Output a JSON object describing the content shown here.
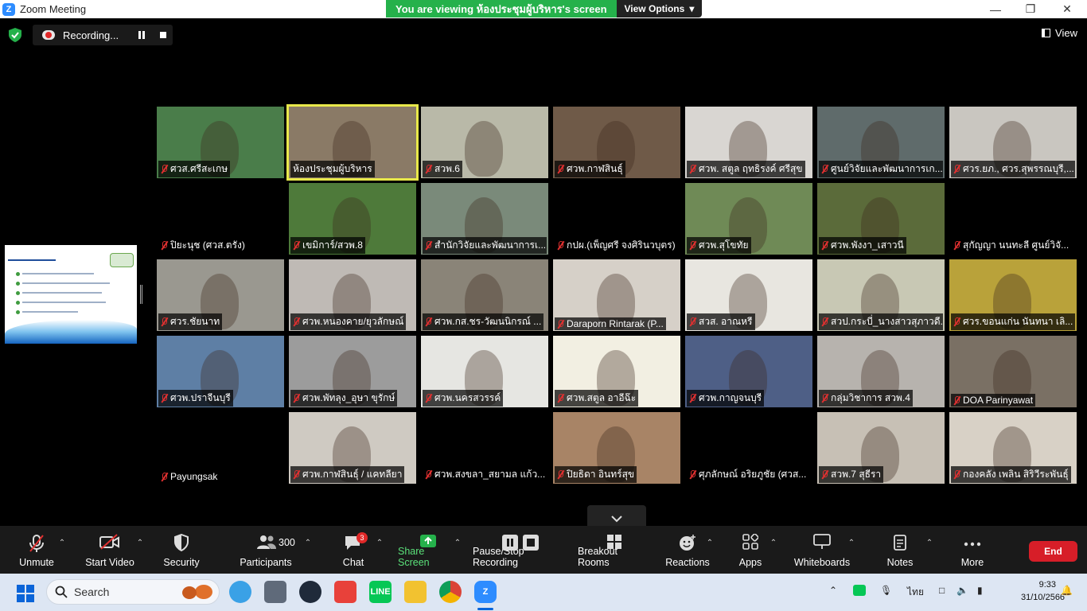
{
  "window": {
    "title": "Zoom Meeting",
    "banner_text": "You are viewing ห้องประชุมผู้บริหาร's screen",
    "view_options": "View Options"
  },
  "top_bar": {
    "recording_label": "Recording...",
    "view_label": "View"
  },
  "participants": [
    {
      "name": "ศวส.ศรีสะเกษ",
      "bg": "#4a7d4a"
    },
    {
      "name": "ห้องประชุมผู้บริหาร",
      "bg": "#8a7a66"
    },
    {
      "name": "สวพ.6",
      "bg": "#b9b9a8"
    },
    {
      "name": "ศวพ.กาฬสินธุ์",
      "bg": "#6f5a48"
    },
    {
      "name": "ศวพ. สตูล ฤทธิรงค์ ศรีสุข",
      "bg": "#d9d6d2"
    },
    {
      "name": "ศูนย์วิจัยและพัฒนาการเก...",
      "bg": "#5f6b6b"
    },
    {
      "name": "ศวร.ยภ., ศวร.สุพรรณบุรี,...",
      "bg": "#c9c6c0"
    },
    {
      "name": "ปิยะนุช (ศวส.ตรัง)",
      "bg": "#000000"
    },
    {
      "name": "เขมิการ์/สวพ.8",
      "bg": "#4e7a3a"
    },
    {
      "name": "สำนักวิจัยและพัฒนาการเ...",
      "bg": "#7a8a7a"
    },
    {
      "name": "กปผ.(เพ็ญศรี จงศิรินวบุตร)",
      "bg": "#000000"
    },
    {
      "name": "ศวพ.สุโขทัย",
      "bg": "#6f8a56"
    },
    {
      "name": "ศวพ.พังงา_เสาวนี",
      "bg": "#5b6b3a"
    },
    {
      "name": "สุกัญญา นนทะลี ศูนย์วิจั...",
      "bg": "#000000"
    },
    {
      "name": "ศวร.ชัยนาท",
      "bg": "#9a9890"
    },
    {
      "name": "ศวพ.หนองคาย/ยุวลักษณ์",
      "bg": "#bfbab5"
    },
    {
      "name": "ศวพ.กส.ชร-วัฒนนิกรณ์ ...",
      "bg": "#8a8478"
    },
    {
      "name": "Daraporn Rintarak (P...",
      "bg": "#d6d0c8"
    },
    {
      "name": "สวส. อาณหรี",
      "bg": "#e8e6e0"
    },
    {
      "name": "สวป.กระบี่_นางสาวสุภาวดี...",
      "bg": "#c8c8b4"
    },
    {
      "name": "ศวร.ขอนแก่น นันทนา เลิ...",
      "bg": "#b9a23a"
    },
    {
      "name": "ศวพ.ปราจีนบุรี",
      "bg": "#5e7fa5"
    },
    {
      "name": "ศวพ.พัทลุง_อุษา ขุรักษ์",
      "bg": "#9c9c9c"
    },
    {
      "name": "ศวพ.นครสวรรค์",
      "bg": "#e6e6e2"
    },
    {
      "name": "ศวพ.สตูล อาอีฉ๊ะ",
      "bg": "#f2efe2"
    },
    {
      "name": "ศวพ.กาญจนบุรี",
      "bg": "#4e5f86"
    },
    {
      "name": "กลุ่มวิชาการ สวพ.4",
      "bg": "#b7b3ae"
    },
    {
      "name": "DOA Parinyawat",
      "bg": "#7a7064"
    },
    {
      "name": "Payungsak",
      "bg": "#000000"
    },
    {
      "name": "ศวพ.กาฬสินธุ์ / แคทลียา",
      "bg": "#cfcac2"
    },
    {
      "name": "ศวพ.สงขลา_สยามล แก้ว...",
      "bg": "#000000"
    },
    {
      "name": "ปิยธิดา อินทร์สุข",
      "bg": "#a88466"
    },
    {
      "name": "ศุภลักษณ์ อริยภูชัย (ศวส...",
      "bg": "#000000"
    },
    {
      "name": "สวพ.7 สุธีรา",
      "bg": "#c7c0b5"
    },
    {
      "name": "กองคลัง เพลิน สิริวีระพันธุ์",
      "bg": "#d8d1c6"
    }
  ],
  "toolbar": {
    "unmute": "Unmute",
    "start_video": "Start Video",
    "security": "Security",
    "participants": "Participants",
    "participants_count": "300",
    "chat": "Chat",
    "chat_badge": "3",
    "share_screen": "Share Screen",
    "pause_stop_recording": "Pause/Stop Recording",
    "breakout_rooms": "Breakout Rooms",
    "reactions": "Reactions",
    "apps": "Apps",
    "whiteboards": "Whiteboards",
    "notes": "Notes",
    "more": "More",
    "end": "End"
  },
  "taskbar": {
    "search_placeholder": "Search",
    "language": "ไทย",
    "time": "9:33",
    "date": "31/10/2566"
  },
  "colors": {
    "banner_green": "#25b14b",
    "end_red": "#d71e28",
    "active_speaker": "#e8e84a"
  }
}
